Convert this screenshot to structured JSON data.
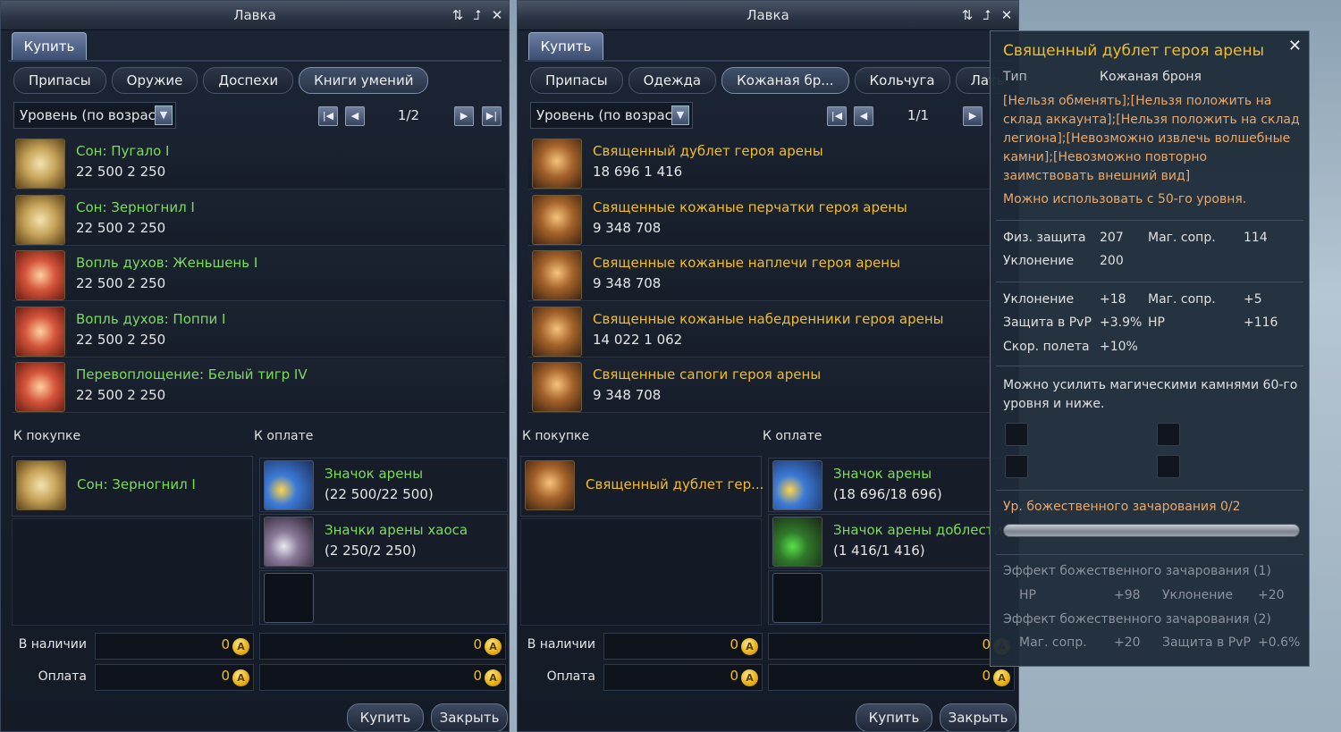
{
  "left": {
    "title": "Лавка",
    "buy_tab": "Купить",
    "categories": [
      "Припасы",
      "Оружие",
      "Доспехи",
      "Книги умений"
    ],
    "sort": "Уровень (по возраст",
    "page": "1/2",
    "items": [
      {
        "name": "Сон: Пугало I",
        "price": "22 500  2 250"
      },
      {
        "name": "Сон: Зерногнил I",
        "price": "22 500  2 250"
      },
      {
        "name": "Вопль духов: Женьшень I",
        "price": "22 500  2 250"
      },
      {
        "name": "Вопль духов: Поппи I",
        "price": "22 500  2 250"
      },
      {
        "name": "Перевоплощение: Белый тигр IV",
        "price": "22 500  2 250"
      }
    ],
    "cart_label": "К покупке",
    "pay_label": "К оплате",
    "cart_item": "Сон: Зерногнил I",
    "payments": [
      {
        "name": "Значок арены",
        "amount": "(22 500/22 500)"
      },
      {
        "name": "Значки арены хаоса",
        "amount": "(2 250/2 250)"
      }
    ],
    "in_stock_label": "В наличии",
    "payment_label": "Оплата",
    "stock_a": "0",
    "stock_b": "0",
    "pay_a": "0",
    "pay_b": "0",
    "buy_button": "Купить",
    "close_button": "Закрыть"
  },
  "right": {
    "title": "Лавка",
    "buy_tab": "Купить",
    "categories": [
      "Припасы",
      "Одежда",
      "Кожаная бр...",
      "Кольчуга",
      "Лать"
    ],
    "sort": "Уровень (по возраст",
    "page": "1/1",
    "items": [
      {
        "name": "Священный дублет героя арены",
        "price": "18 696  1 416"
      },
      {
        "name": "Священные кожаные перчатки героя арены",
        "price": "9 348  708"
      },
      {
        "name": "Священные кожаные наплечи героя арены",
        "price": "9 348  708"
      },
      {
        "name": "Священные кожаные набедренники героя арены",
        "price": "14 022  1 062"
      },
      {
        "name": "Священные сапоги героя арены",
        "price": "9 348  708"
      }
    ],
    "cart_label": "К покупке",
    "pay_label": "К оплате",
    "cart_item": "Священный дублет гер...",
    "payments": [
      {
        "name": "Значок арены",
        "amount": "(18 696/18 696)"
      },
      {
        "name": "Значок арены доблести",
        "amount": "(1 416/1 416)"
      }
    ],
    "in_stock_label": "В наличии",
    "payment_label": "Оплата",
    "stock_a": "0",
    "stock_b": "0",
    "pay_a": "0",
    "pay_b": "0",
    "buy_button": "Купить",
    "close_button": "Закрыть"
  },
  "tooltip": {
    "title": "Священный дублет героя арены",
    "type_label": "Тип",
    "type_value": "Кожаная броня",
    "restrictions": "[Нельзя обменять];[Нельзя положить на склад аккаунта];[Нельзя положить на склад легиона];[Невозможно извлечь волшебные камни];[Невозможно повторно заимствовать внешний вид]",
    "level_req": "Можно использовать с 50-го уровня.",
    "base_stats": [
      {
        "label": "Физ. защита",
        "value": "207"
      },
      {
        "label": "Маг. сопр.",
        "value": "114"
      },
      {
        "label": "Уклонение",
        "value": "200"
      }
    ],
    "bonus_stats": [
      {
        "label": "Уклонение",
        "value": "+18"
      },
      {
        "label": "Маг. сопр.",
        "value": "+5"
      },
      {
        "label": "Защита в PvP",
        "value": "+3.9%"
      },
      {
        "label": "HP",
        "value": "+116"
      },
      {
        "label": "Скор. полета",
        "value": "+10%"
      }
    ],
    "manastone_text": "Можно усилить магическими камнями 60-го уровня и ниже.",
    "enchant_level": "Ур. божественного зачарования 0/2",
    "effect1_title": "Эффект божественного зачарования (1)",
    "effect1": [
      {
        "label": "HP",
        "value": "+98"
      },
      {
        "label": "Уклонение",
        "value": "+20"
      }
    ],
    "effect2_title": "Эффект божественного зачарования (2)",
    "effect2": [
      {
        "label": "Маг. сопр.",
        "value": "+20"
      },
      {
        "label": "Защита в PvP",
        "value": "+0.6%"
      }
    ]
  },
  "icons": {
    "refresh": "refresh-icon",
    "popout": "popout-icon",
    "close": "close-icon",
    "coin": "coin-icon",
    "dropdown": "chevron-down-icon"
  },
  "glyphs": {
    "refresh": "⇅",
    "popout": "⮥",
    "close": "✕",
    "first": "|◀",
    "prev": "◀",
    "next": "▶",
    "last": "▶|",
    "dropdown": "▼",
    "coin": "A"
  },
  "colors": {
    "item_name_green": "#7cdc5a",
    "item_name_gold": "#f0bd2a",
    "tooltip_title": "#f0bd2a",
    "restriction_text": "#e9a86a"
  }
}
